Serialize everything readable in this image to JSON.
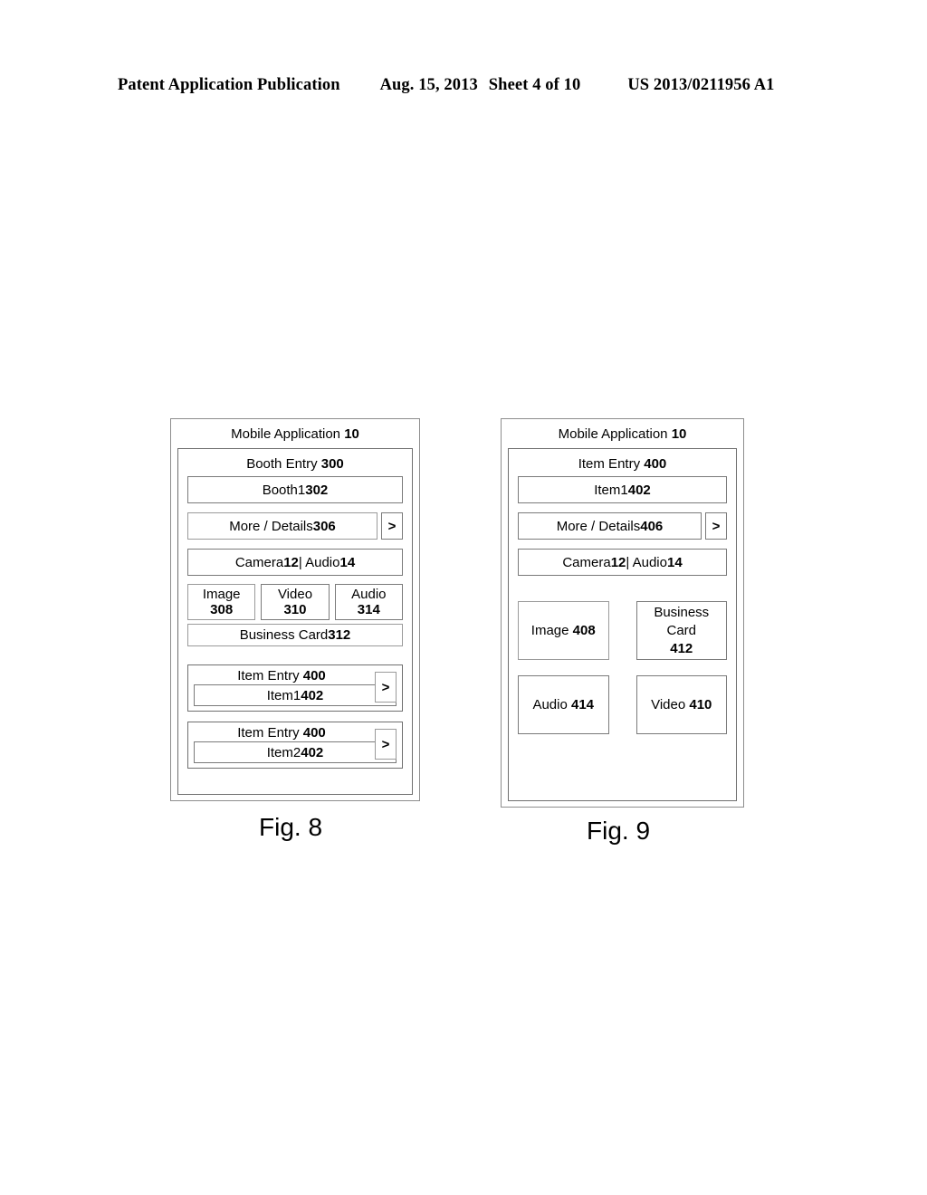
{
  "page_header": {
    "publication": "Patent Application Publication",
    "date": "Aug. 15, 2013",
    "sheet": "Sheet 4 of 10",
    "patent_number": "US 2013/0211956 A1"
  },
  "figures": [
    {
      "id": "fig-8",
      "caption": "Fig. 8",
      "app_title": "Mobile Application 10",
      "screen_title": "Booth Entry 300",
      "primary_row": "Booth 1 302",
      "details_row": {
        "label": "More / Details 306",
        "arrow": ">"
      },
      "camera_row": "Camera 12 | Audio 14",
      "media_row": [
        {
          "label": "Image",
          "ref": "308"
        },
        {
          "label": "Video",
          "ref": "310"
        },
        {
          "label": "Audio",
          "ref": "314"
        }
      ],
      "business_card_row": "Business Card 312",
      "item_entries": [
        {
          "title": "Item Entry 400",
          "value": "Item 1 402",
          "arrow": ">"
        },
        {
          "title": "Item Entry 400",
          "value": "Item 2 402",
          "arrow": ">"
        }
      ]
    },
    {
      "id": "fig-9",
      "caption": "Fig. 9",
      "app_title": "Mobile Application 10",
      "screen_title": "Item Entry 400",
      "primary_row": "Item 1 402",
      "details_row": {
        "label": "More / Details 406",
        "arrow": ">"
      },
      "camera_row": "Camera 12 | Audio 14",
      "media_grid": [
        {
          "line1": "Image 408",
          "line2": "",
          "line3": ""
        },
        {
          "line1": "Business",
          "line2": "Card",
          "line3": "412"
        },
        {
          "line1": "Audio 414",
          "line2": "",
          "line3": ""
        },
        {
          "line1": "Video 410",
          "line2": "",
          "line3": ""
        }
      ]
    }
  ]
}
